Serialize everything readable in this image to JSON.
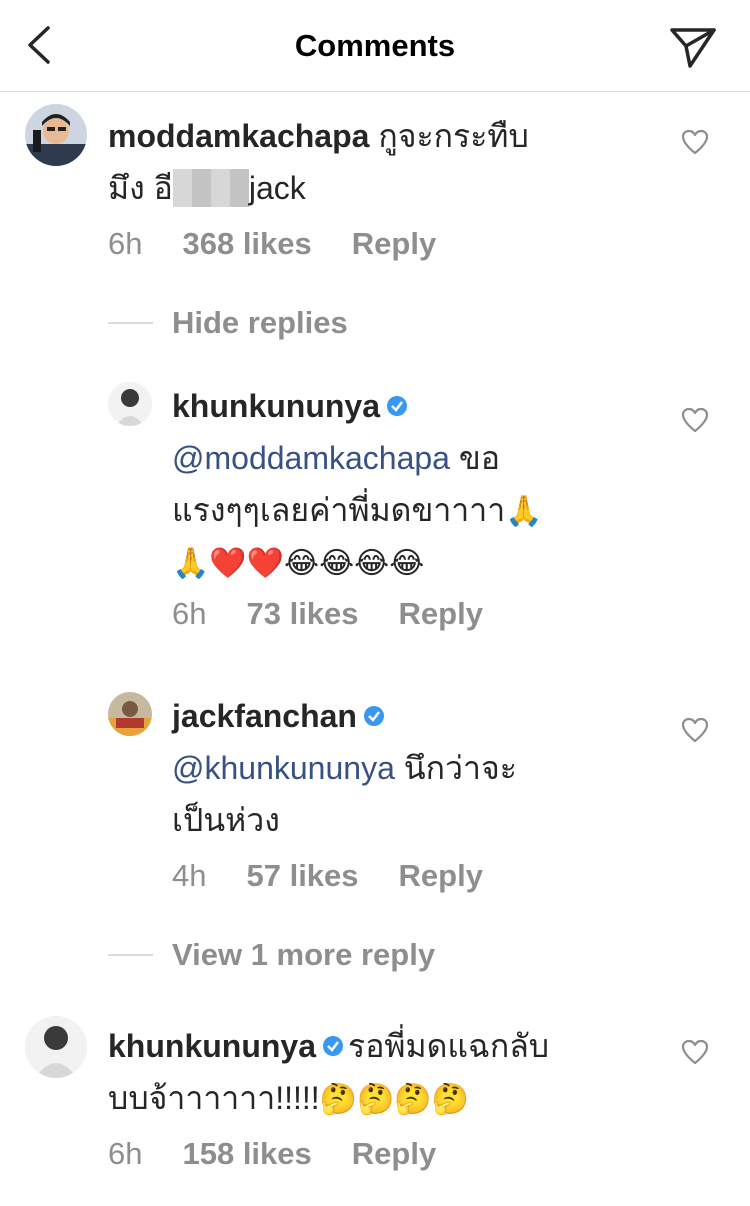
{
  "header": {
    "title": "Comments",
    "back_icon": "chevron-left-icon",
    "send_icon": "paper-plane-icon"
  },
  "comments": [
    {
      "username": "moddamkachapa",
      "text_line1": "กูจะกระทืบ",
      "text_line2_pre": "มึง อี",
      "text_line2_post": "jack",
      "time": "6h",
      "likes": "368 likes",
      "reply": "Reply"
    },
    {
      "username": "khunkununya",
      "mention": "@moddamkachapa",
      "text_line1_post": " ขอ",
      "text_line2": "แรงๆๆเลยค่าพี่มดขาาาา",
      "emoji_line2": "🙏",
      "emoji_line3": "🙏❤️❤️😂😂😂😂",
      "time": "6h",
      "likes": "73 likes",
      "reply": "Reply"
    },
    {
      "username": "jackfanchan",
      "mention": "@khunkununya",
      "text_line1_post": " นึกว่าจะ",
      "text_line2": "เป็นห่วง",
      "time": "4h",
      "likes": "57 likes",
      "reply": "Reply"
    },
    {
      "username": "khunkununya",
      "text_line1_post": "รอพี่มดแฉกลับ",
      "text_line2": "บบจ้าาาาาา!!!!!",
      "emoji_line2": "🤔🤔🤔🤔",
      "time": "6h",
      "likes": "158 likes",
      "reply": "Reply"
    }
  ],
  "thread": {
    "hide_replies": "Hide replies",
    "view_more": "View 1 more reply"
  },
  "colors": {
    "text": "#262626",
    "muted": "#8e8e8e",
    "mention": "#385185",
    "verified": "#3897f0",
    "divider": "#dbdbdb"
  }
}
